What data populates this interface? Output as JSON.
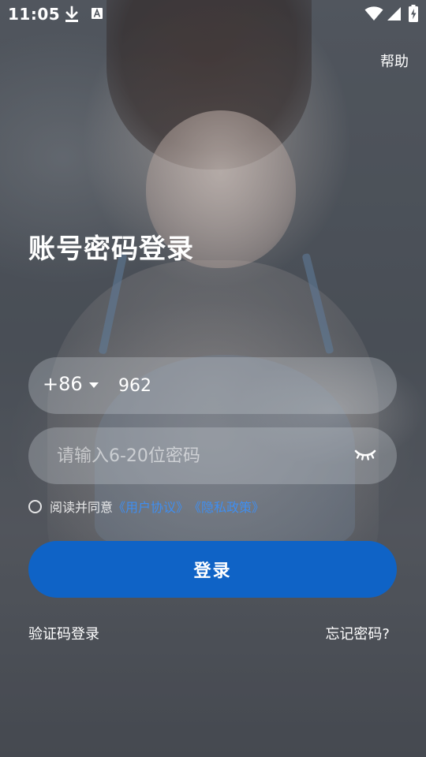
{
  "status_bar": {
    "time": "11:05",
    "icons": [
      "download-icon",
      "keyboard-a-icon",
      "wifi-icon",
      "signal-icon",
      "battery-charging-icon"
    ]
  },
  "header": {
    "help_label": "帮助"
  },
  "main": {
    "title": "账号密码登录",
    "phone": {
      "country_code": "+86",
      "value": "962"
    },
    "password": {
      "placeholder": "请输入6-20位密码",
      "toggle_icon": "eye-closed-icon"
    },
    "agreement": {
      "prefix": "阅读并同意",
      "user_agreement": "《用户协议》",
      "privacy_policy": "《隐私政策》"
    },
    "login_label": "登录",
    "sms_login_label": "验证码登录",
    "forgot_password_label": "忘记密码?"
  },
  "colors": {
    "primary_button": "#0f63c6",
    "link": "#3f8ef0",
    "field_bg": "rgba(200,204,210,0.32)"
  }
}
